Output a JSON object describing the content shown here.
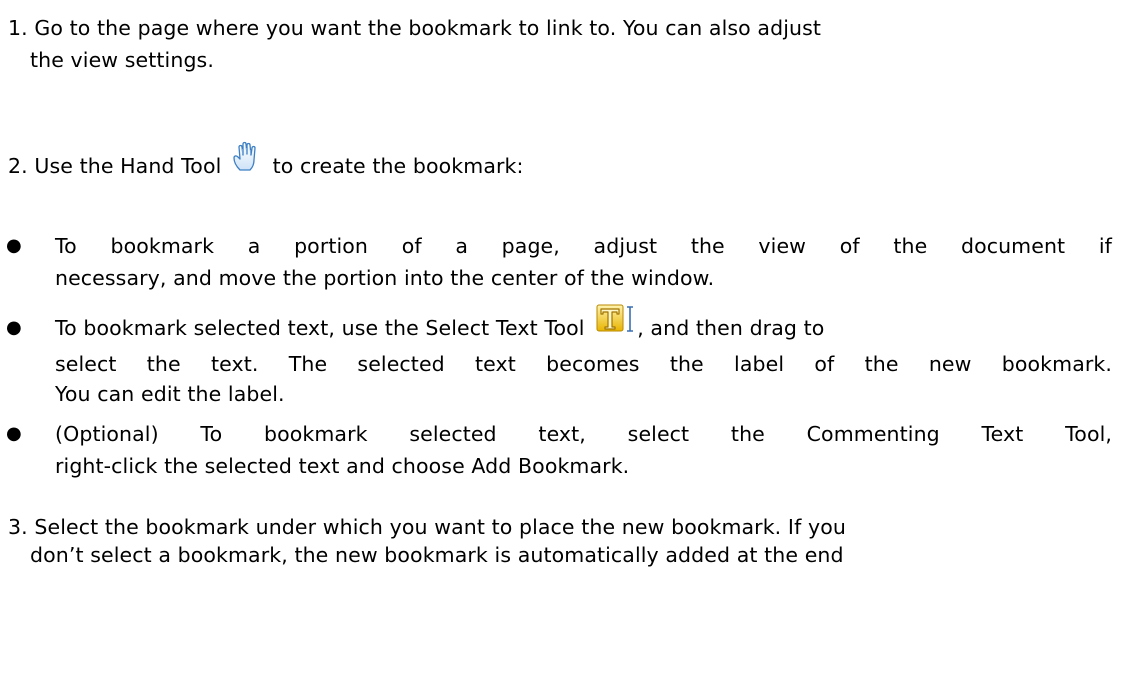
{
  "step1": {
    "number": "1.",
    "line1": "Go to the page where you want the bookmark to link to. You can also adjust",
    "line2": "the view settings."
  },
  "step2": {
    "number": "2.",
    "before_icon": "Use the Hand Tool",
    "icon": "hand-tool-icon",
    "after_icon": "to create the bookmark:"
  },
  "bullets": [
    {
      "line1": "To bookmark a portion of a page, adjust the view of the document if",
      "line2": "necessary, and move the portion into the center of the window."
    },
    {
      "line1_before_icon": "To bookmark selected text, use the Select Text Tool",
      "icon": "select-text-tool-icon",
      "line1_after_icon": ", and then drag to",
      "line2": "select the text. The selected text becomes the label of the new bookmark.",
      "line3": "You can edit the label."
    },
    {
      "line1": "(Optional) To bookmark selected text, select the Commenting Text Tool,",
      "line2": "right-click the selected text and choose Add Bookmark."
    }
  ],
  "step3": {
    "number": "3.",
    "line1": "Select the bookmark under which you want to place the new bookmark. If you",
    "line2": "don’t select a bookmark, the new bookmark is automatically added at the end"
  },
  "bullet_char": "●"
}
